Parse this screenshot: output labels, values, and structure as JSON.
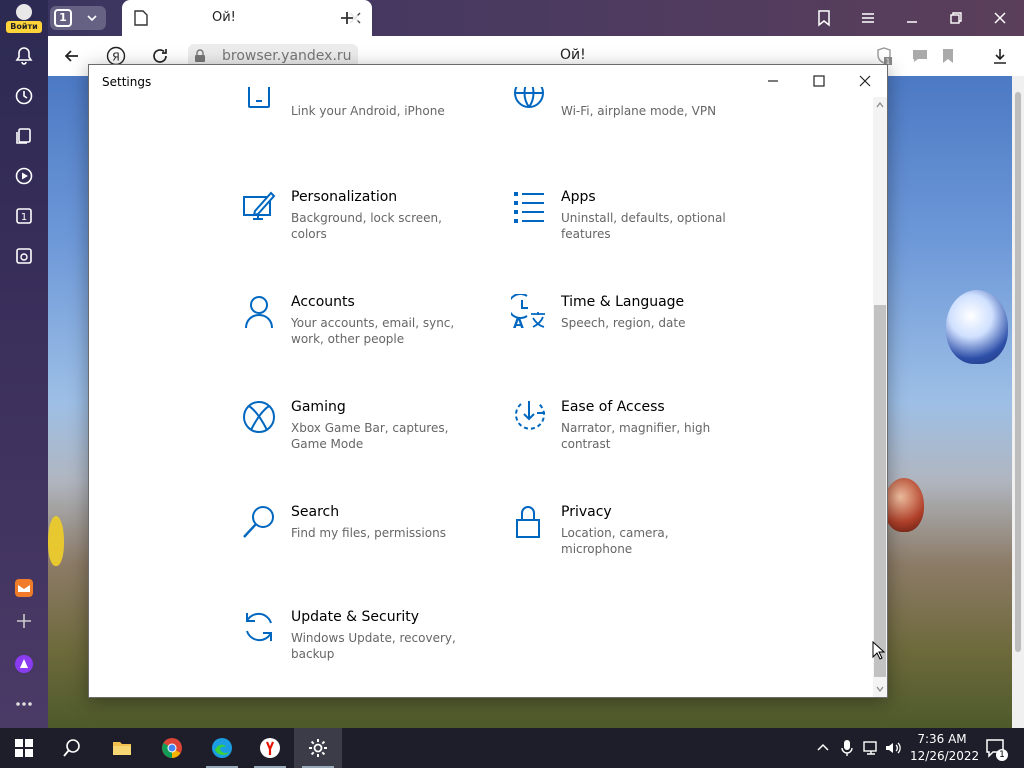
{
  "browser": {
    "login_label": "Войти",
    "tab_count": "1",
    "tab_title": "Ой!",
    "url": "browser.yandex.ru",
    "page_title": "Ой!",
    "yandex_letter": "Я",
    "sidebar_badge": "1",
    "bookmark_badge": "1"
  },
  "settings": {
    "window_title": "Settings",
    "tiles": [
      {
        "name": "",
        "desc": "Link your Android, iPhone",
        "icon": "phone-icon"
      },
      {
        "name": "",
        "desc": "Wi-Fi, airplane mode, VPN",
        "icon": "globe-icon"
      },
      {
        "name": "Personalization",
        "desc": "Background, lock screen, colors",
        "icon": "paint-icon"
      },
      {
        "name": "Apps",
        "desc": "Uninstall, defaults, optional features",
        "icon": "apps-list-icon"
      },
      {
        "name": "Accounts",
        "desc": "Your accounts, email, sync, work, other people",
        "icon": "person-icon"
      },
      {
        "name": "Time & Language",
        "desc": "Speech, region, date",
        "icon": "time-language-icon"
      },
      {
        "name": "Gaming",
        "desc": "Xbox Game Bar, captures, Game Mode",
        "icon": "xbox-icon"
      },
      {
        "name": "Ease of Access",
        "desc": "Narrator, magnifier, high contrast",
        "icon": "ease-of-access-icon"
      },
      {
        "name": "Search",
        "desc": "Find my files, permissions",
        "icon": "search-icon"
      },
      {
        "name": "Privacy",
        "desc": "Location, camera, microphone",
        "icon": "lock-icon"
      },
      {
        "name": "Update & Security",
        "desc": "Windows Update, recovery, backup",
        "icon": "sync-icon"
      }
    ]
  },
  "taskbar": {
    "time": "7:36 AM",
    "date": "12/26/2022",
    "notification_count": "1"
  },
  "colors": {
    "accent": "#0067c0",
    "taskbar": "#1e1e2a"
  }
}
